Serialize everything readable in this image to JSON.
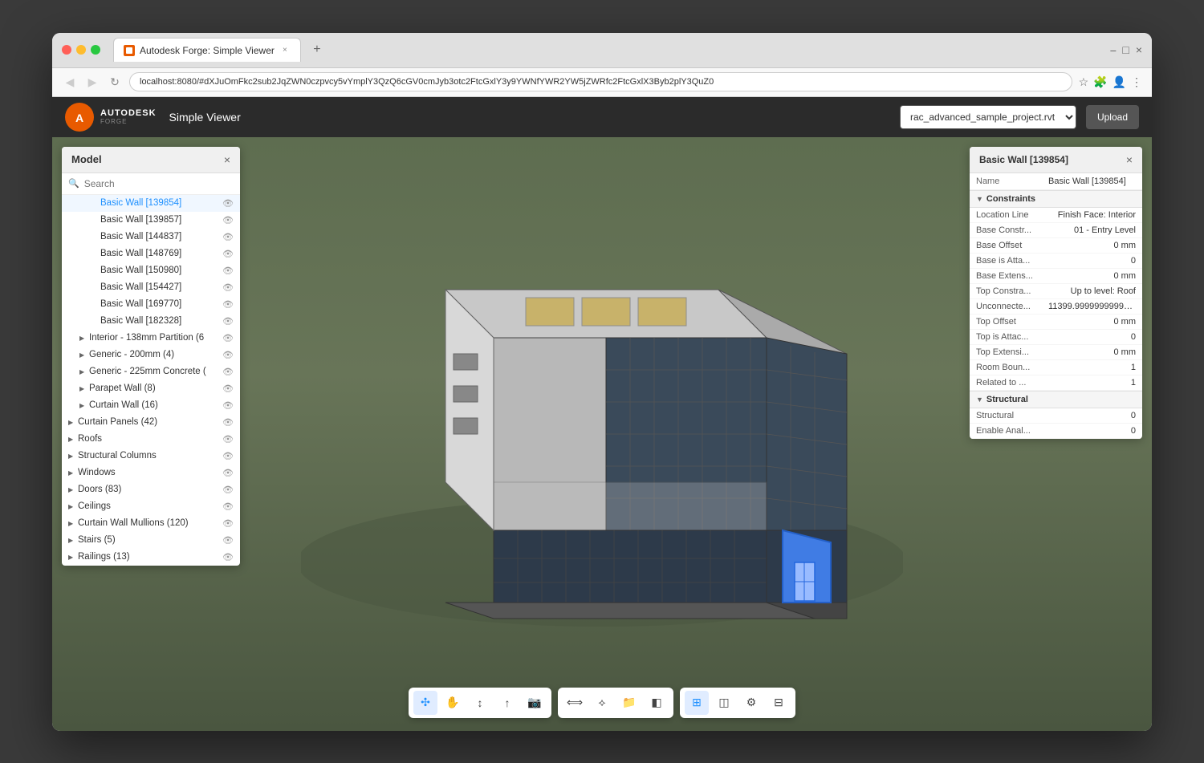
{
  "browser": {
    "traffic_lights": [
      "close",
      "minimize",
      "maximize"
    ],
    "tab_title": "Autodesk Forge: Simple Viewer",
    "url": "localhost:8080/#dXJuOmFkc2sub2JqZWN0czpvcy5vYmplY3QzQ6cGV0cmJyb3otc2FtcGxlY3y9YWNfYWR2YW5jZWRfc2FtcGxlX3Byb2plY3QuZ0",
    "window_controls": [
      "bookmark",
      "star",
      "extensions",
      "screenshot",
      "menu"
    ]
  },
  "app": {
    "logo_title": "AUTODESK",
    "logo_sub": "FORGE",
    "app_title": "Simple Viewer",
    "file_select_value": "rac_advanced_sample_project.rvt",
    "upload_label": "Upload"
  },
  "model_panel": {
    "title": "Model",
    "close_label": "×",
    "search_placeholder": "Search",
    "tree_items": [
      {
        "id": "bw139854",
        "indent": 2,
        "label": "Basic Wall [139854]",
        "selected": true,
        "has_eye": true,
        "arrow": ""
      },
      {
        "id": "bw139857",
        "indent": 2,
        "label": "Basic Wall [139857]",
        "selected": false,
        "has_eye": true,
        "arrow": ""
      },
      {
        "id": "bw144837",
        "indent": 2,
        "label": "Basic Wall [144837]",
        "selected": false,
        "has_eye": true,
        "arrow": ""
      },
      {
        "id": "bw148769",
        "indent": 2,
        "label": "Basic Wall [148769]",
        "selected": false,
        "has_eye": true,
        "arrow": ""
      },
      {
        "id": "bw150980",
        "indent": 2,
        "label": "Basic Wall [150980]",
        "selected": false,
        "has_eye": true,
        "arrow": ""
      },
      {
        "id": "bw154427",
        "indent": 2,
        "label": "Basic Wall [154427]",
        "selected": false,
        "has_eye": true,
        "arrow": ""
      },
      {
        "id": "bw169770",
        "indent": 2,
        "label": "Basic Wall [169770]",
        "selected": false,
        "has_eye": true,
        "arrow": ""
      },
      {
        "id": "bw182328",
        "indent": 2,
        "label": "Basic Wall [182328]",
        "selected": false,
        "has_eye": true,
        "arrow": ""
      },
      {
        "id": "int138",
        "indent": 1,
        "label": "Interior - 138mm Partition (6",
        "selected": false,
        "has_eye": true,
        "arrow": "▶"
      },
      {
        "id": "gen200",
        "indent": 1,
        "label": "Generic - 200mm (4)",
        "selected": false,
        "has_eye": true,
        "arrow": "▶"
      },
      {
        "id": "gen225",
        "indent": 1,
        "label": "Generic - 225mm Concrete (",
        "selected": false,
        "has_eye": true,
        "arrow": "▶"
      },
      {
        "id": "par8",
        "indent": 1,
        "label": "Parapet Wall (8)",
        "selected": false,
        "has_eye": true,
        "arrow": "▶"
      },
      {
        "id": "curt16",
        "indent": 1,
        "label": "Curtain Wall (16)",
        "selected": false,
        "has_eye": true,
        "arrow": "▶"
      },
      {
        "id": "curtpan42",
        "indent": 0,
        "label": "Curtain Panels (42)",
        "selected": false,
        "has_eye": true,
        "arrow": "▶"
      },
      {
        "id": "roofs",
        "indent": 0,
        "label": "Roofs",
        "selected": false,
        "has_eye": true,
        "arrow": "▶"
      },
      {
        "id": "structcol",
        "indent": 0,
        "label": "Structural Columns",
        "selected": false,
        "has_eye": true,
        "arrow": "▶"
      },
      {
        "id": "windows",
        "indent": 0,
        "label": "Windows",
        "selected": false,
        "has_eye": true,
        "arrow": "▶"
      },
      {
        "id": "doors83",
        "indent": 0,
        "label": "Doors (83)",
        "selected": false,
        "has_eye": true,
        "arrow": "▶"
      },
      {
        "id": "ceilings",
        "indent": 0,
        "label": "Ceilings",
        "selected": false,
        "has_eye": true,
        "arrow": "▶"
      },
      {
        "id": "curtmull120",
        "indent": 0,
        "label": "Curtain Wall Mullions (120)",
        "selected": false,
        "has_eye": true,
        "arrow": "▶"
      },
      {
        "id": "stairs5",
        "indent": 0,
        "label": "Stairs (5)",
        "selected": false,
        "has_eye": true,
        "arrow": "▶"
      },
      {
        "id": "rail13",
        "indent": 0,
        "label": "Railings (13)",
        "selected": false,
        "has_eye": true,
        "arrow": "▶"
      }
    ]
  },
  "properties_panel": {
    "title": "Basic Wall [139854]",
    "close_label": "×",
    "name_key": "Name",
    "name_val": "Basic Wall [139854]",
    "sections": [
      {
        "name": "Constraints",
        "expanded": true,
        "rows": [
          {
            "key": "Location Line",
            "val": "Finish Face: Interior"
          },
          {
            "key": "Base Constr...",
            "val": "01 - Entry Level"
          },
          {
            "key": "Base Offset",
            "val": "0 mm"
          },
          {
            "key": "Base is Atta...",
            "val": "0"
          },
          {
            "key": "Base Extens...",
            "val": "0 mm"
          },
          {
            "key": "Top Constra...",
            "val": "Up to level: Roof"
          },
          {
            "key": "Unconnecte...",
            "val": "11399.999999999942 mm"
          },
          {
            "key": "Top Offset",
            "val": "0 mm"
          },
          {
            "key": "Top is Attac...",
            "val": "0"
          },
          {
            "key": "Top Extensi...",
            "val": "0 mm"
          },
          {
            "key": "Room Boun...",
            "val": "1"
          },
          {
            "key": "Related to ...",
            "val": "1"
          }
        ]
      },
      {
        "name": "Structural",
        "expanded": true,
        "rows": [
          {
            "key": "Structural",
            "val": "0"
          },
          {
            "key": "Enable Anal...",
            "val": "0"
          }
        ]
      }
    ]
  },
  "toolbar": {
    "left_group": [
      {
        "id": "select",
        "icon": "⊹",
        "label": "Select",
        "active": true
      },
      {
        "id": "pan",
        "icon": "✋",
        "label": "Pan",
        "active": false
      },
      {
        "id": "orbit",
        "icon": "↕",
        "label": "Orbit",
        "active": false
      },
      {
        "id": "walk",
        "icon": "🚶",
        "label": "Walk",
        "active": false
      },
      {
        "id": "camera",
        "icon": "🎥",
        "label": "Camera",
        "active": false
      }
    ],
    "right_group_1": [
      {
        "id": "measure",
        "icon": "📏",
        "label": "Measure",
        "active": false
      },
      {
        "id": "explode",
        "icon": "💥",
        "label": "Explode",
        "active": false
      },
      {
        "id": "open",
        "icon": "📂",
        "label": "Open",
        "active": false
      },
      {
        "id": "model",
        "icon": "⬛",
        "label": "Model",
        "active": false
      }
    ],
    "right_group_2": [
      {
        "id": "grid",
        "icon": "⊞",
        "label": "Grid",
        "active": true
      },
      {
        "id": "section",
        "icon": "▦",
        "label": "Section",
        "active": false
      },
      {
        "id": "settings",
        "icon": "⚙",
        "label": "Settings",
        "active": false
      },
      {
        "id": "split",
        "icon": "⊡",
        "label": "Split",
        "active": false
      }
    ]
  },
  "colors": {
    "accent_blue": "#1e90ff",
    "panel_bg": "#ffffff",
    "viewport_bg": "#5e6d50",
    "selected_wall": "#4080ff"
  }
}
